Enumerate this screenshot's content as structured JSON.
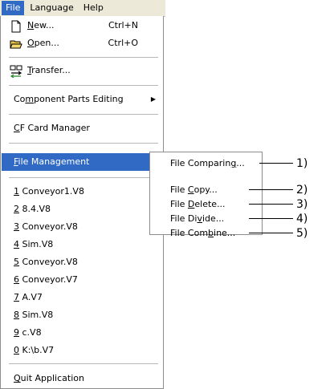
{
  "menubar": {
    "items": [
      "File",
      "Language",
      "Help"
    ]
  },
  "file_menu": {
    "new": {
      "accel": "N",
      "rest": "ew...",
      "shortcut": "Ctrl+N",
      "icon": "new-document-icon"
    },
    "open": {
      "accel": "O",
      "rest": "pen...",
      "shortcut": "Ctrl+O",
      "icon": "open-folder-icon"
    },
    "transfer": {
      "accel": "T",
      "rest": "ransfer...",
      "icon": "transfer-icon"
    },
    "component_parts_editing": {
      "pre": "Co",
      "accel": "m",
      "rest": "ponent Parts Editing"
    },
    "cf_card_manager": {
      "accel": "C",
      "rest": "F Card Manager"
    },
    "file_management": {
      "accel": "F",
      "rest": "ile Management"
    },
    "recent_files": [
      {
        "accel": "1",
        "label": " Conveyor1.V8"
      },
      {
        "accel": "2",
        "label": " 8.4.V8"
      },
      {
        "accel": "3",
        "label": " Conveyor.V8"
      },
      {
        "accel": "4",
        "label": " Sim.V8"
      },
      {
        "accel": "5",
        "label": " Conveyor.V8"
      },
      {
        "accel": "6",
        "label": " Conveyor.V7"
      },
      {
        "accel": "7",
        "label": " A.V7"
      },
      {
        "accel": "8",
        "label": " Sim.V8"
      },
      {
        "accel": "9",
        "label": " c.V8"
      },
      {
        "accel": "0",
        "label": " K:\\b.V7"
      }
    ],
    "quit": {
      "accel": "Q",
      "rest": "uit Application"
    }
  },
  "submenu": {
    "items": [
      {
        "pre": "File Comparin",
        "accel": "g",
        "rest": "..."
      },
      {
        "pre": "File ",
        "accel": "C",
        "rest": "opy..."
      },
      {
        "pre": "File ",
        "accel": "D",
        "rest": "elete..."
      },
      {
        "pre": "File Di",
        "accel": "v",
        "rest": "ide..."
      },
      {
        "pre": "File Com",
        "accel": "b",
        "rest": "ine..."
      }
    ]
  },
  "callouts": [
    "1)",
    "2)",
    "3)",
    "4)",
    "5)"
  ],
  "colors": {
    "highlight": "#316ac5",
    "menubar_bg": "#ece9d8"
  }
}
